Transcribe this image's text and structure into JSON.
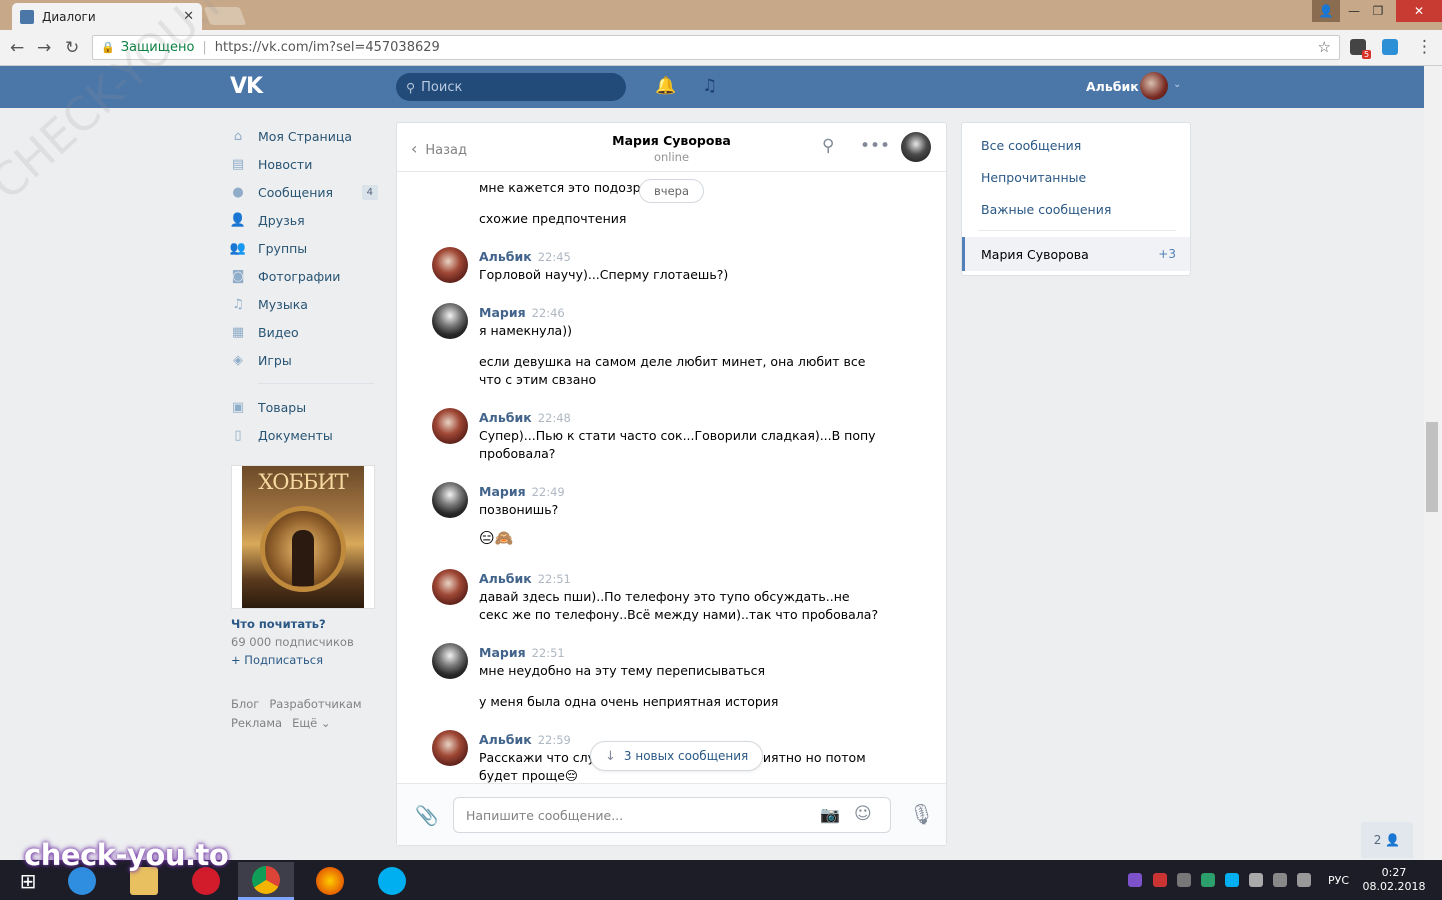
{
  "browser": {
    "tab_title": "Диалоги",
    "secure_label": "Защищено",
    "url": "https://vk.com/im?sel=457038629",
    "ext_badge": "5"
  },
  "vk_header": {
    "logo": "VK",
    "search_placeholder": "Поиск",
    "user_name": "Альбик"
  },
  "sidebar": {
    "items": [
      {
        "label": "Моя Страница",
        "icon": "home-icon"
      },
      {
        "label": "Новости",
        "icon": "news-icon"
      },
      {
        "label": "Сообщения",
        "icon": "messages-icon",
        "badge": "4"
      },
      {
        "label": "Друзья",
        "icon": "friends-icon"
      },
      {
        "label": "Группы",
        "icon": "groups-icon"
      },
      {
        "label": "Фотографии",
        "icon": "photos-icon"
      },
      {
        "label": "Музыка",
        "icon": "music-icon"
      },
      {
        "label": "Видео",
        "icon": "video-icon"
      },
      {
        "label": "Игры",
        "icon": "games-icon"
      },
      {
        "label": "Товары",
        "icon": "market-icon"
      },
      {
        "label": "Документы",
        "icon": "documents-icon"
      }
    ],
    "ad": {
      "poster_title": "ХОББИТ",
      "title": "Что почитать?",
      "subscribers": "69 000 подписчиков",
      "join": "+ Подписаться"
    },
    "footer": {
      "blog": "Блог",
      "developers": "Разработчикам",
      "ads": "Реклама",
      "more": "Ещё ⌄"
    }
  },
  "chat": {
    "back_label": "Назад",
    "peer_name": "Мария Суворова",
    "peer_status": "online",
    "date_divider": "вчера",
    "new_messages": "3 новых сообщения",
    "messages": [
      {
        "author": "",
        "time": "",
        "lines": [
          "мне кажется это подозрит",
          "схожие предпочтения"
        ]
      },
      {
        "author": "Альбик",
        "time": "22:45",
        "lines": [
          "Горловой научу)...Сперму глотаешь?)"
        ]
      },
      {
        "author": "Мария",
        "time": "22:46",
        "lines": [
          "я намекнула))",
          "если девушка на самом деле любит минет, она любит все что с этим свзано"
        ]
      },
      {
        "author": "Альбик",
        "time": "22:48",
        "lines": [
          "Супер)...Пью к стати часто сок...Говорили сладкая)...В попу пробовала?"
        ]
      },
      {
        "author": "Мария",
        "time": "22:49",
        "lines": [
          "позвонишь?",
          "😑🙈"
        ]
      },
      {
        "author": "Альбик",
        "time": "22:51",
        "lines": [
          "давай здесь пши)..По телефону это тупо обсуждать..не секс же по телефону..Всё между нами)..так что пробовала?"
        ]
      },
      {
        "author": "Мария",
        "time": "22:51",
        "lines": [
          "мне неудобно на эту тему переписываться",
          "у меня была одна очень неприятная история"
        ]
      },
      {
        "author": "Альбик",
        "time": "22:59",
        "lines": [
          "Расскажи что слу",
          "риятно но потом",
          "будет проще😔"
        ]
      }
    ],
    "composer_placeholder": "Напишите сообщение..."
  },
  "right_panel": {
    "all": "Все сообщения",
    "unread": "Непрочитанные",
    "important": "Важные сообщения",
    "active_dialog": "Мария Суворова",
    "active_count": "+3"
  },
  "chat_button": "2 👤",
  "taskbar": {
    "lang": "РУС",
    "time": "0:27",
    "date": "08.02.2018"
  },
  "watermark": "check-you.to",
  "diag_watermark": "CHECK-YOU.ME"
}
